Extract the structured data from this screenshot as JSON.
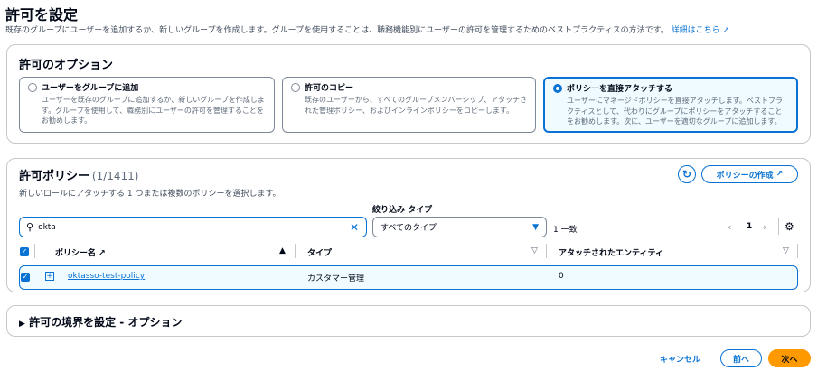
{
  "header": {
    "title": "許可を設定",
    "description": "既存のグループにユーザーを追加するか、新しいグループを作成します。グループを使用することは、職務機能別にユーザーの許可を管理するためのベストプラクティスの方法です。",
    "learn_more": "詳細はこちら"
  },
  "options": {
    "title": "許可のオプション",
    "cards": [
      {
        "title": "ユーザーをグループに追加",
        "desc": "ユーザーを既存のグループに追加するか、新しいグループを作成します。グループを使用して、職務別にユーザーの許可を管理することをお勧めします。",
        "selected": false
      },
      {
        "title": "許可のコピー",
        "desc": "既存のユーザーから、すべてのグループメンバーシップ、アタッチされた管理ポリシー、およびインラインポリシーをコピーします。",
        "selected": false
      },
      {
        "title": "ポリシーを直接アタッチする",
        "desc": "ユーザーにマネージドポリシーを直接アタッチします。ベストプラクティスとして、代わりにグループにポリシーをアタッチすることをお勧めします。次に、ユーザーを適切なグループに追加します。",
        "selected": true
      }
    ]
  },
  "policies": {
    "title": "許可ポリシー",
    "count": "(1/1411)",
    "description": "新しいロールにアタッチする 1 つまたは複数のポリシーを選択します。",
    "create_label": "ポリシーの作成",
    "filter_label": "絞り込み タイプ",
    "search_value": "okta",
    "type_value": "すべてのタイプ",
    "match_count": "1 一致",
    "page": "1",
    "columns": [
      "ポリシー名",
      "タイプ",
      "アタッチされたエンティティ"
    ],
    "rows": [
      {
        "name": "oktasso-test-policy",
        "type": "カスタマー管理",
        "entities": "0",
        "checked": true
      }
    ]
  },
  "boundary": {
    "title": "許可の境界を設定 - オプション"
  },
  "footer": {
    "cancel": "キャンセル",
    "prev": "前へ",
    "next": "次へ"
  },
  "colors": {
    "accent": "#0972d3",
    "primary": "#ff9900"
  }
}
